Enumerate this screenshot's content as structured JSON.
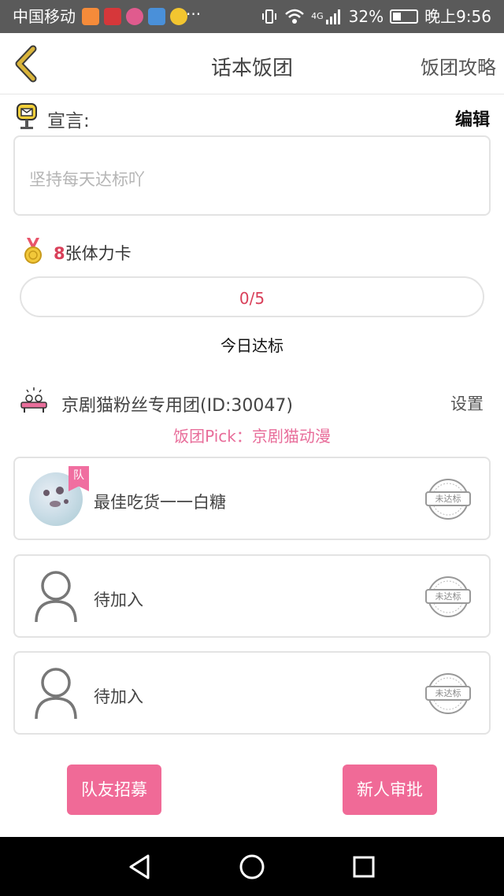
{
  "status_bar": {
    "carrier": "中国移动",
    "battery": "32%",
    "time": "晚上9:56",
    "network": "4G",
    "more": "···",
    "app_icon_colors": [
      "#f58b3a",
      "#d6373a",
      "#e05b8e",
      "#4a90d9",
      "#f2c530"
    ]
  },
  "header": {
    "title": "话本饭团",
    "guide_label": "饭团攻略",
    "back_icon": "chevron-left-icon"
  },
  "manifesto": {
    "label": "宣言:",
    "edit_label": "编辑",
    "text": "坚持每天达标吖"
  },
  "stamina": {
    "count": "8",
    "suffix": "张体力卡"
  },
  "progress": {
    "text": "0/5",
    "fraction": 0,
    "caption": "今日达标"
  },
  "group": {
    "name": "京剧猫粉丝专用团(ID:30047)",
    "settings_label": "设置",
    "pick": "饭团Pick：京剧猫动漫"
  },
  "members": [
    {
      "name": "最佳吃货一一白糖",
      "badge": "队",
      "status": "未达标",
      "has_photo": true
    },
    {
      "name": "待加入",
      "status": "未达标",
      "has_photo": false
    },
    {
      "name": "待加入",
      "status": "未达标",
      "has_photo": false
    }
  ],
  "buttons": {
    "recruit": "队友招募",
    "approve": "新人审批"
  },
  "colors": {
    "accent_pink": "#f06a97",
    "count_red": "#d9405a",
    "pick_pink": "#e86d9a",
    "back_arrow": "#c9a12a"
  }
}
